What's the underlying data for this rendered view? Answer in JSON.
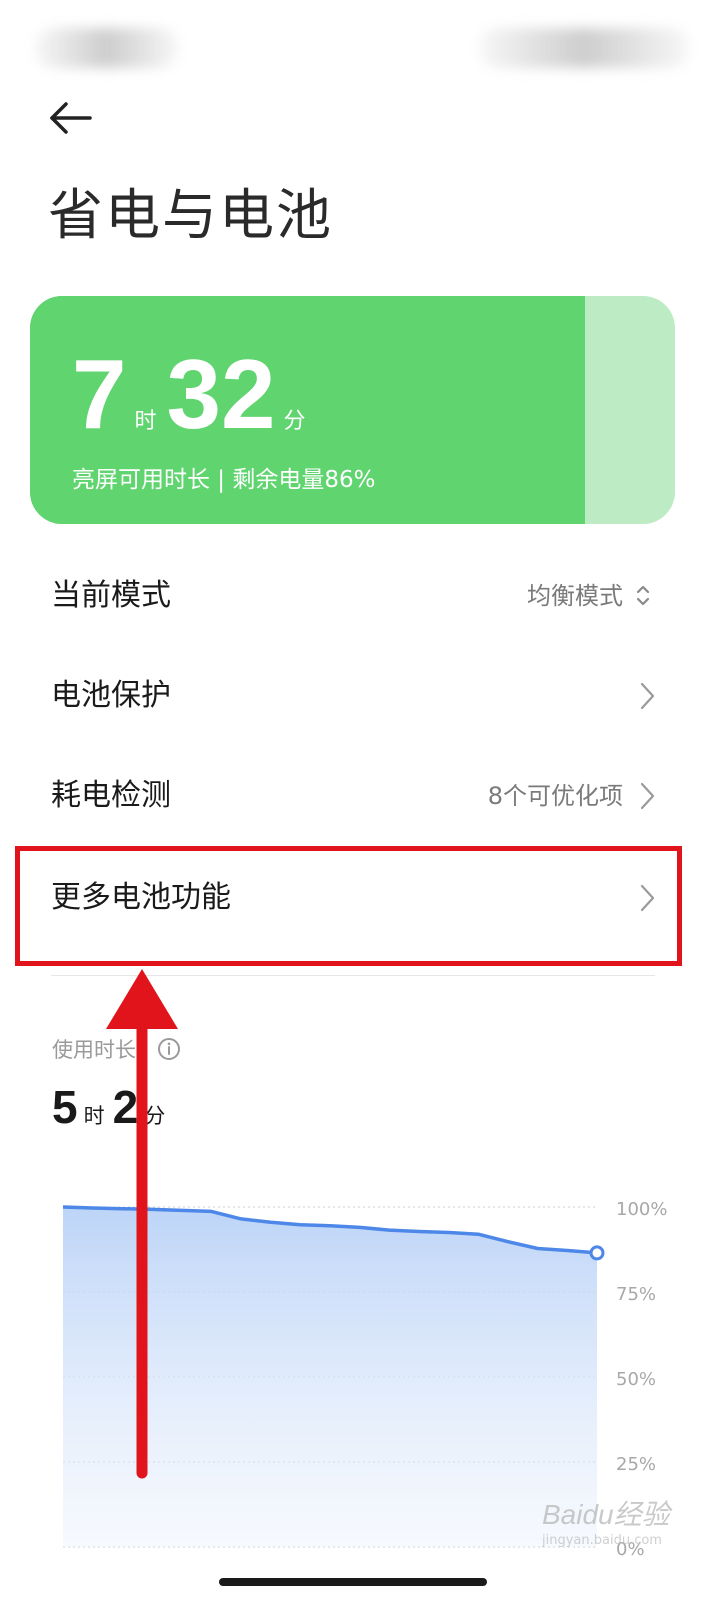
{
  "header": {
    "title": "省电与电池"
  },
  "battery_card": {
    "hours": "7",
    "hours_unit": "时",
    "minutes": "32",
    "minutes_unit": "分",
    "subtitle": "亮屏可用时长 | 剩余电量86%",
    "level_fraction": 0.86,
    "fill_color": "#5fd46f",
    "empty_color": "#bcebc4"
  },
  "settings": [
    {
      "label": "当前模式",
      "value": "均衡模式",
      "icon": "up-down-icon"
    },
    {
      "label": "电池保护",
      "value": "",
      "icon": "chevron-right-icon"
    },
    {
      "label": "耗电检测",
      "value": "8个可优化项",
      "icon": "chevron-right-icon"
    },
    {
      "label": "更多电池功能",
      "value": "",
      "icon": "chevron-right-icon"
    }
  ],
  "highlight_color": "#e0141a",
  "usage": {
    "label": "使用时长",
    "hours": "5",
    "hours_unit": "时",
    "minutes": "2",
    "minutes_unit": "分"
  },
  "chart_data": {
    "type": "area",
    "ylim": [
      0,
      100
    ],
    "y_ticks": [
      "100%",
      "75%",
      "50%",
      "25%",
      "0%"
    ],
    "series": [
      {
        "values": [
          100,
          99.7,
          99.5,
          99.3,
          99.0,
          98.7,
          96.5,
          95.5,
          94.8,
          94.5,
          94.0,
          93.2,
          92.8,
          92.5,
          92.0,
          89.8,
          87.8,
          87.2,
          86.5
        ],
        "color": "#4d87e8"
      }
    ],
    "grid": true
  },
  "watermark": {
    "brand": "Baidu经验",
    "url": "jingyan.baidu.com"
  }
}
